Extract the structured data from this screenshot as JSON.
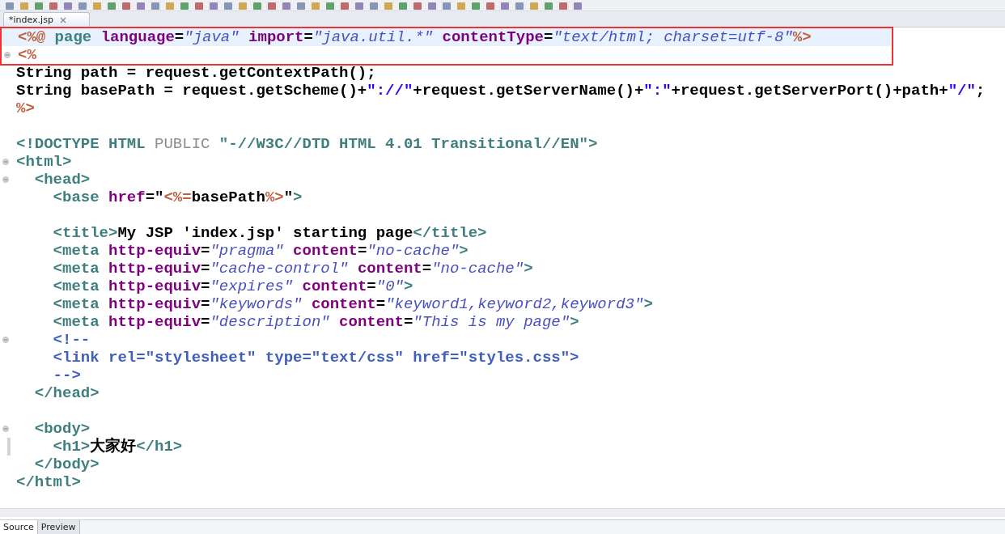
{
  "editor_tab": {
    "label": "*index.jsp",
    "selected": true
  },
  "lines": [
    {
      "fold": false,
      "current": true,
      "changed": false,
      "boxed": true,
      "tokens": [
        {
          "kind": "jsp",
          "t": "<%@ "
        },
        {
          "kind": "tag",
          "t": "page "
        },
        {
          "kind": "attr",
          "t": "language"
        },
        {
          "kind": "txt",
          "t": "="
        },
        {
          "kind": "str",
          "t": "\"java\" "
        },
        {
          "kind": "attr",
          "t": "import"
        },
        {
          "kind": "txt",
          "t": "="
        },
        {
          "kind": "str",
          "t": "\"java.util.*\" "
        },
        {
          "kind": "attr",
          "t": "contentType"
        },
        {
          "kind": "txt",
          "t": "="
        },
        {
          "kind": "str",
          "t": "\"text/html; charset=utf-8\""
        },
        {
          "kind": "jsp",
          "t": "%>"
        }
      ]
    },
    {
      "fold": true,
      "current": false,
      "changed": false,
      "boxed": true,
      "tokens": [
        {
          "kind": "jsp",
          "t": "<%"
        }
      ]
    },
    {
      "fold": false,
      "current": false,
      "changed": false,
      "boxed": false,
      "tokens": [
        {
          "kind": "txt",
          "t": "String path = request.getContextPath();"
        }
      ]
    },
    {
      "fold": false,
      "current": false,
      "changed": false,
      "boxed": false,
      "tokens": [
        {
          "kind": "txt",
          "t": "String basePath = request.getScheme()+"
        },
        {
          "kind": "js",
          "t": "\"://\""
        },
        {
          "kind": "txt",
          "t": "+request.getServerName()+"
        },
        {
          "kind": "js",
          "t": "\":\""
        },
        {
          "kind": "txt",
          "t": "+request.getServerPort()+path+"
        },
        {
          "kind": "js",
          "t": "\"/\""
        },
        {
          "kind": "txt",
          "t": ";"
        }
      ]
    },
    {
      "fold": false,
      "current": false,
      "changed": false,
      "boxed": false,
      "tokens": [
        {
          "kind": "jsp",
          "t": "%>"
        }
      ]
    },
    {
      "fold": false,
      "current": false,
      "changed": false,
      "boxed": false
    },
    {
      "fold": false,
      "current": false,
      "changed": false,
      "boxed": false,
      "tokens": [
        {
          "kind": "tag",
          "t": "<!DOCTYPE HTML "
        },
        {
          "kind": "kw",
          "t": "PUBLIC "
        },
        {
          "kind": "tag",
          "t": "\"-//W3C//DTD HTML 4.01 Transitional//EN\">"
        }
      ]
    },
    {
      "fold": true,
      "current": false,
      "changed": false,
      "boxed": false,
      "tokens": [
        {
          "kind": "tag",
          "t": "<html>"
        }
      ]
    },
    {
      "fold": true,
      "current": false,
      "changed": false,
      "boxed": false,
      "tokens": [
        {
          "kind": "tag",
          "t": "  <head>"
        }
      ]
    },
    {
      "fold": false,
      "current": false,
      "changed": false,
      "boxed": false,
      "tokens": [
        {
          "kind": "tag",
          "t": "    <base "
        },
        {
          "kind": "attr",
          "t": "href"
        },
        {
          "kind": "txt",
          "t": "=\""
        },
        {
          "kind": "jsp",
          "t": "<%="
        },
        {
          "kind": "txt",
          "t": "basePath"
        },
        {
          "kind": "jsp",
          "t": "%>"
        },
        {
          "kind": "txt",
          "t": "\""
        },
        {
          "kind": "tag",
          "t": ">"
        }
      ]
    },
    {
      "fold": false,
      "current": false,
      "changed": false,
      "boxed": false
    },
    {
      "fold": false,
      "current": false,
      "changed": false,
      "boxed": false,
      "tokens": [
        {
          "kind": "tag",
          "t": "    <title>"
        },
        {
          "kind": "txt",
          "t": "My JSP 'index.jsp' starting page"
        },
        {
          "kind": "tag",
          "t": "</title>"
        }
      ]
    },
    {
      "fold": false,
      "current": false,
      "changed": false,
      "boxed": false,
      "tokens": [
        {
          "kind": "tag",
          "t": "    <meta "
        },
        {
          "kind": "attr",
          "t": "http-equiv"
        },
        {
          "kind": "txt",
          "t": "="
        },
        {
          "kind": "str",
          "t": "\"pragma\" "
        },
        {
          "kind": "attr",
          "t": "content"
        },
        {
          "kind": "txt",
          "t": "="
        },
        {
          "kind": "str",
          "t": "\"no-cache\""
        },
        {
          "kind": "tag",
          "t": ">"
        }
      ]
    },
    {
      "fold": false,
      "current": false,
      "changed": false,
      "boxed": false,
      "tokens": [
        {
          "kind": "tag",
          "t": "    <meta "
        },
        {
          "kind": "attr",
          "t": "http-equiv"
        },
        {
          "kind": "txt",
          "t": "="
        },
        {
          "kind": "str",
          "t": "\"cache-control\" "
        },
        {
          "kind": "attr",
          "t": "content"
        },
        {
          "kind": "txt",
          "t": "="
        },
        {
          "kind": "str",
          "t": "\"no-cache\""
        },
        {
          "kind": "tag",
          "t": ">"
        }
      ]
    },
    {
      "fold": false,
      "current": false,
      "changed": false,
      "boxed": false,
      "tokens": [
        {
          "kind": "tag",
          "t": "    <meta "
        },
        {
          "kind": "attr",
          "t": "http-equiv"
        },
        {
          "kind": "txt",
          "t": "="
        },
        {
          "kind": "str",
          "t": "\"expires\" "
        },
        {
          "kind": "attr",
          "t": "content"
        },
        {
          "kind": "txt",
          "t": "="
        },
        {
          "kind": "str",
          "t": "\"0\""
        },
        {
          "kind": "tag",
          "t": ">"
        }
      ]
    },
    {
      "fold": false,
      "current": false,
      "changed": false,
      "boxed": false,
      "tokens": [
        {
          "kind": "tag",
          "t": "    <meta "
        },
        {
          "kind": "attr",
          "t": "http-equiv"
        },
        {
          "kind": "txt",
          "t": "="
        },
        {
          "kind": "str",
          "t": "\"keywords\" "
        },
        {
          "kind": "attr",
          "t": "content"
        },
        {
          "kind": "txt",
          "t": "="
        },
        {
          "kind": "str",
          "t": "\"keyword1,keyword2,keyword3\""
        },
        {
          "kind": "tag",
          "t": ">"
        }
      ]
    },
    {
      "fold": false,
      "current": false,
      "changed": false,
      "boxed": false,
      "tokens": [
        {
          "kind": "tag",
          "t": "    <meta "
        },
        {
          "kind": "attr",
          "t": "http-equiv"
        },
        {
          "kind": "txt",
          "t": "="
        },
        {
          "kind": "str",
          "t": "\"description\" "
        },
        {
          "kind": "attr",
          "t": "content"
        },
        {
          "kind": "txt",
          "t": "="
        },
        {
          "kind": "str",
          "t": "\"This is my page\""
        },
        {
          "kind": "tag",
          "t": ">"
        }
      ]
    },
    {
      "fold": true,
      "current": false,
      "changed": false,
      "boxed": false,
      "tokens": [
        {
          "kind": "cm",
          "t": "    <!--"
        }
      ]
    },
    {
      "fold": false,
      "current": false,
      "changed": false,
      "boxed": false,
      "tokens": [
        {
          "kind": "cm",
          "t": "    <link rel=\"stylesheet\" type=\"text/css\" href=\"styles.css\">"
        }
      ]
    },
    {
      "fold": false,
      "current": false,
      "changed": false,
      "boxed": false,
      "tokens": [
        {
          "kind": "cm",
          "t": "    -->"
        }
      ]
    },
    {
      "fold": false,
      "current": false,
      "changed": false,
      "boxed": false,
      "tokens": [
        {
          "kind": "tag",
          "t": "  </head>"
        }
      ]
    },
    {
      "fold": false,
      "current": false,
      "changed": false,
      "boxed": false
    },
    {
      "fold": true,
      "current": false,
      "changed": false,
      "boxed": false,
      "tokens": [
        {
          "kind": "tag",
          "t": "  <body>"
        }
      ]
    },
    {
      "fold": false,
      "current": false,
      "changed": true,
      "boxed": false,
      "tokens": [
        {
          "kind": "tag",
          "t": "    <h1>"
        },
        {
          "kind": "txt",
          "t": "大家好"
        },
        {
          "kind": "tag",
          "t": "</h1>"
        }
      ]
    },
    {
      "fold": false,
      "current": false,
      "changed": false,
      "boxed": false,
      "tokens": [
        {
          "kind": "tag",
          "t": "  </body>"
        }
      ]
    },
    {
      "fold": false,
      "current": false,
      "changed": false,
      "boxed": false,
      "tokens": [
        {
          "kind": "tag",
          "t": "</html>"
        }
      ]
    }
  ],
  "bottom_tabs": [
    {
      "label": "Source",
      "selected": true
    },
    {
      "label": "Preview",
      "selected": false
    }
  ]
}
